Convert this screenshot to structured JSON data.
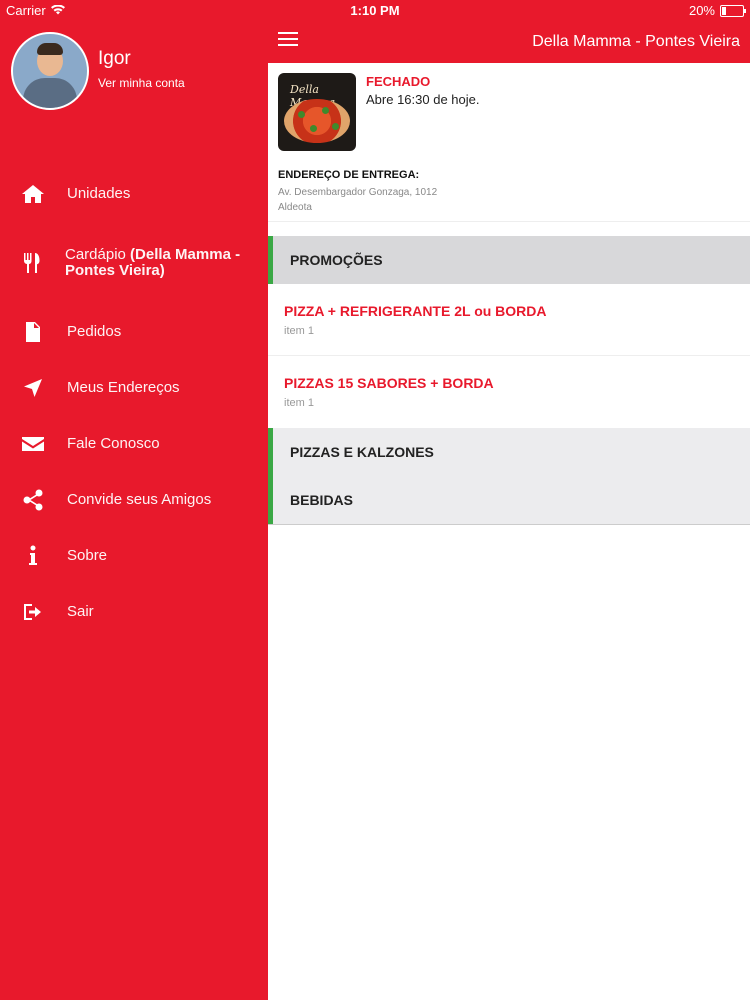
{
  "status_bar": {
    "carrier": "Carrier",
    "time": "1:10 PM",
    "battery": "20%",
    "battery_level": 0.2
  },
  "sidebar": {
    "user_name": "Igor",
    "account_link": "Ver minha conta",
    "items": [
      {
        "label": "Unidades",
        "icon": "home-icon"
      },
      {
        "label_prefix": "Cardápio",
        "label_bold": "(Della Mamma - Pontes Vieira)",
        "icon": "utensils-icon"
      },
      {
        "label": "Pedidos",
        "icon": "document-icon"
      },
      {
        "label": "Meus Endereços",
        "icon": "location-arrow-icon"
      },
      {
        "label": "Fale Conosco",
        "icon": "envelope-icon"
      },
      {
        "label": "Convide seus Amigos",
        "icon": "share-icon"
      },
      {
        "label": "Sobre",
        "icon": "info-icon"
      },
      {
        "label": "Sair",
        "icon": "sign-out-icon"
      }
    ]
  },
  "header": {
    "title": "Della Mamma - Pontes Vieira"
  },
  "store": {
    "logo_text": "Della Mamma",
    "status": "FECHADO",
    "hours": "Abre 16:30 de hoje.",
    "address_title": "ENDEREÇO DE ENTREGA:",
    "address_line1": "Av. Desembargador Gonzaga, 1012",
    "address_line2": "Aldeota"
  },
  "menu": {
    "sections": [
      {
        "title": "PROMOÇÕES"
      },
      {
        "title": "PIZZAS E KALZONES"
      },
      {
        "title": "BEBIDAS"
      }
    ],
    "products": [
      {
        "name": "PIZZA + REFRIGERANTE 2L ou BORDA",
        "desc": "item 1"
      },
      {
        "name": "PIZZAS 15 SABORES + BORDA",
        "desc": "item 1"
      }
    ]
  },
  "colors": {
    "brand_red": "#e8192c",
    "section_accent": "#3aa845"
  }
}
